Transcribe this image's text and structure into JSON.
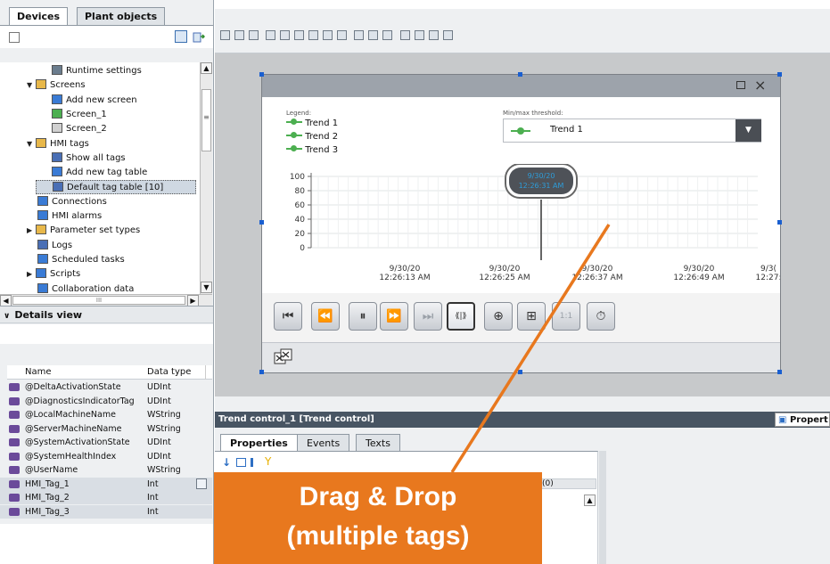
{
  "left_panel": {
    "tabs": [
      "Devices",
      "Plant objects"
    ],
    "tree": [
      {
        "label": "Runtime settings",
        "level": 2,
        "icon": "wrench-icon",
        "color": "#6b7d8e"
      },
      {
        "label": "Screens",
        "level": 1,
        "icon": "folder-icon",
        "expanded": true,
        "color": "#e8b84a"
      },
      {
        "label": "Add new screen",
        "level": 2,
        "icon": "add-screen-icon",
        "color": "#3a7bd5"
      },
      {
        "label": "Screen_1",
        "level": 2,
        "icon": "screen-icon",
        "color": "#4caf50"
      },
      {
        "label": "Screen_2",
        "level": 2,
        "icon": "screen-icon",
        "color": "#d0d0d0"
      },
      {
        "label": "HMI tags",
        "level": 1,
        "icon": "folder-tags-icon",
        "expanded": true,
        "color": "#e8b84a"
      },
      {
        "label": "Show all tags",
        "level": 2,
        "icon": "tags-icon",
        "color": "#4a6fb5"
      },
      {
        "label": "Add new tag table",
        "level": 2,
        "icon": "add-table-icon",
        "color": "#3a7bd5"
      },
      {
        "label": "Default tag table [10]",
        "level": 2,
        "icon": "tag-table-icon",
        "color": "#4a6fb5",
        "selected": true
      },
      {
        "label": "Connections",
        "level": 1,
        "icon": "connections-icon",
        "color": "#3a7bd5"
      },
      {
        "label": "HMI alarms",
        "level": 1,
        "icon": "alarm-icon",
        "color": "#3a7bd5"
      },
      {
        "label": "Parameter set types",
        "level": 1,
        "icon": "folder-icon",
        "collapsed": true,
        "color": "#e8b84a"
      },
      {
        "label": "Logs",
        "level": 1,
        "icon": "logs-icon",
        "color": "#4a6fb5"
      },
      {
        "label": "Scheduled tasks",
        "level": 1,
        "icon": "scheduler-icon",
        "color": "#3a7bd5"
      },
      {
        "label": "Scripts",
        "level": 1,
        "icon": "scripts-icon",
        "collapsed": true,
        "color": "#3a7bd5"
      },
      {
        "label": "Collaboration data",
        "level": 1,
        "icon": "collab-icon",
        "color": "#3a7bd5"
      }
    ],
    "hscroll_label": "III",
    "details_title": "Details view",
    "details_headers": [
      "Name",
      "Data type"
    ],
    "details_rows": [
      {
        "name": "@DeltaActivationState",
        "type": "UDInt"
      },
      {
        "name": "@DiagnosticsIndicatorTag",
        "type": "UDInt"
      },
      {
        "name": "@LocalMachineName",
        "type": "WString"
      },
      {
        "name": "@ServerMachineName",
        "type": "WString"
      },
      {
        "name": "@SystemActivationState",
        "type": "UDInt"
      },
      {
        "name": "@SystemHealthIndex",
        "type": "UDInt"
      },
      {
        "name": "@UserName",
        "type": "WString"
      },
      {
        "name": "HMI_Tag_1",
        "type": "Int",
        "selected": true
      },
      {
        "name": "HMI_Tag_2",
        "type": "Int",
        "selected": true
      },
      {
        "name": "HMI_Tag_3",
        "type": "Int",
        "selected": true
      }
    ]
  },
  "trend": {
    "legend_title": "Legend:",
    "legend_items": [
      "Trend 1",
      "Trend 2",
      "Trend 3"
    ],
    "threshold_title": "Min/max threshold:",
    "threshold_value": "Trend 1",
    "y_ticks": [
      "100",
      "80",
      "60",
      "40",
      "20",
      "0"
    ],
    "x_ticks": [
      {
        "date": "9/30/20",
        "time": "12:26:13 AM"
      },
      {
        "date": "9/30/20",
        "time": "12:26:25 AM"
      },
      {
        "date": "9/30/20",
        "time": "12:26:37 AM"
      },
      {
        "date": "9/30/20",
        "time": "12:26:49 AM"
      },
      {
        "date": "9/3(",
        "time": "12:27:"
      }
    ],
    "cursor_date": "9/30/20",
    "cursor_time": "12:26:31 AM",
    "accent": "#2e9cd8",
    "line_color": "#4caf50"
  },
  "properties": {
    "title": "Trend control_1 [Trend control]",
    "right_tab": "Propert",
    "tabs": [
      "Properties",
      "Events",
      "Texts"
    ],
    "cell_text": "(0)"
  },
  "callout": {
    "line1": "Drag & Drop",
    "line2": "(multiple tags)",
    "color": "#e8781e"
  }
}
